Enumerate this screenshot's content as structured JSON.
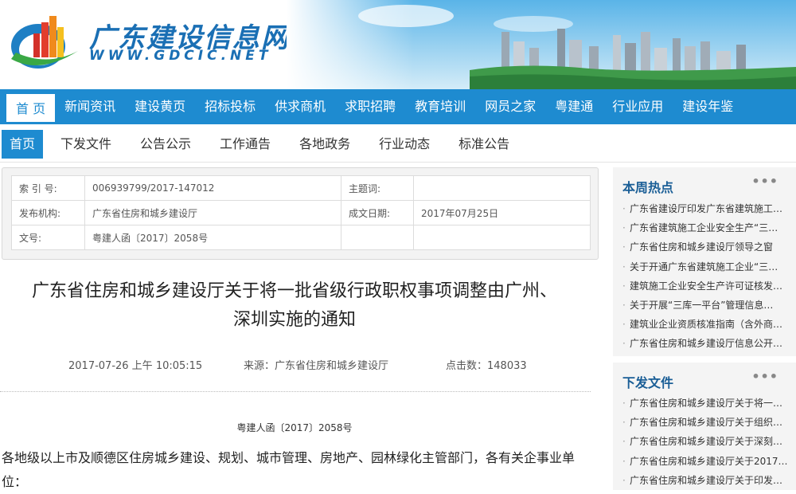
{
  "header": {
    "site_name": "广东建设信息网",
    "site_url": "WWW.GDCIC.NET"
  },
  "main_nav": [
    {
      "label": "首 页",
      "active": true
    },
    {
      "label": "新闻资讯"
    },
    {
      "label": "建设黄页"
    },
    {
      "label": "招标投标"
    },
    {
      "label": "供求商机"
    },
    {
      "label": "求职招聘"
    },
    {
      "label": "教育培训"
    },
    {
      "label": "网员之家"
    },
    {
      "label": "粤建通"
    },
    {
      "label": "行业应用"
    },
    {
      "label": "建设年鉴"
    }
  ],
  "sub_nav": [
    {
      "label": "首页",
      "active": true
    },
    {
      "label": "下发文件"
    },
    {
      "label": "公告公示"
    },
    {
      "label": "工作通告"
    },
    {
      "label": "各地政务"
    },
    {
      "label": "行业动态"
    },
    {
      "label": "标准公告"
    }
  ],
  "meta": {
    "index_label": "索 引 号:",
    "index_value": "006939799/2017-147012",
    "subject_label": "主题词:",
    "subject_value": "",
    "issuer_label": "发布机构:",
    "issuer_value": "广东省住房和城乡建设厅",
    "date_label": "成文日期:",
    "date_value": "2017年07月25日",
    "docno_label": "文号:",
    "docno_value": "粤建人函〔2017〕2058号"
  },
  "article": {
    "title_line1": "广东省住房和城乡建设厅关于将一批省级行政职权事项调整由广州、",
    "title_line2": "深圳实施的通知",
    "datetime": "2017-07-26 上午 10:05:15",
    "source": "来源：广东省住房和城乡建设厅",
    "clicks": "点击数：148033",
    "doc_number": "粤建人函〔2017〕2058号",
    "body_line1": "各地级以上市及顺德区住房城乡建设、规划、城市管理、房地产、园林绿化主管部门，各有关企事业单",
    "body_line2": "位："
  },
  "sidebar": {
    "hot": {
      "title": "本周热点",
      "more": "•••",
      "items": [
        "广东省建设厅印发广东省建筑施工…",
        "广东省建筑施工企业安全生产“三…",
        "广东省住房和城乡建设厅领导之窗",
        "关于开通广东省建筑施工企业“三…",
        "建筑施工企业安全生产许可证核发…",
        "关于开展“三库一平台”管理信息…",
        "建筑业企业资质核准指南（含外商…",
        "广东省住房和城乡建设厅信息公开…"
      ]
    },
    "docs": {
      "title": "下发文件",
      "more": "•••",
      "items": [
        "广东省住房和城乡建设厅关于将一…",
        "广东省住房和城乡建设厅关于组织…",
        "广东省住房和城乡建设厅关于深刻…",
        "广东省住房和城乡建设厅关于2017…",
        "广东省住房和城乡建设厅关于印发…"
      ]
    }
  }
}
